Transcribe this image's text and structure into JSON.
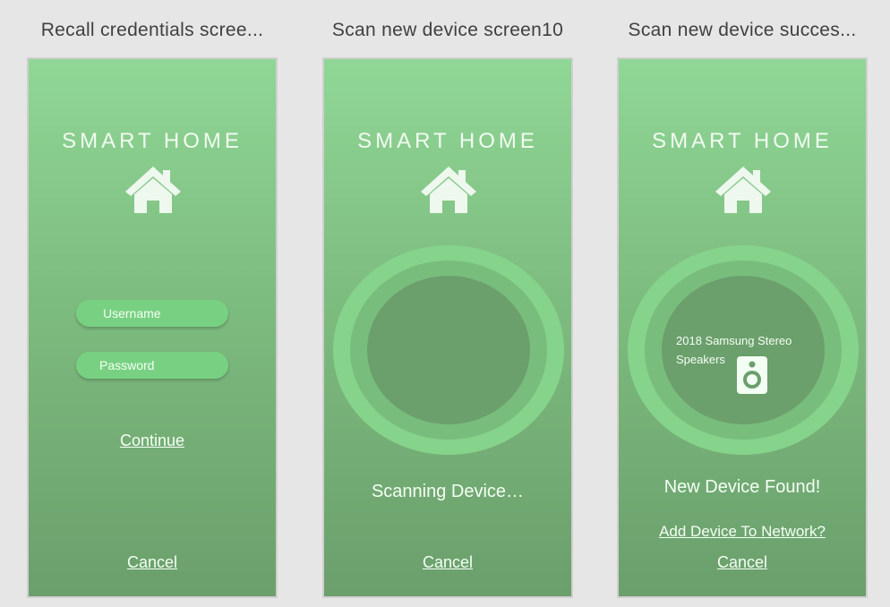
{
  "artboards": [
    {
      "title": "Recall credentials scree...",
      "brand": "SMART HOME",
      "username_placeholder": "Username",
      "password_placeholder": "Password",
      "continue_label": "Continue",
      "cancel_label": "Cancel"
    },
    {
      "title": "Scan new device screen10",
      "brand": "SMART HOME",
      "status": "Scanning Device…",
      "cancel_label": "Cancel"
    },
    {
      "title": "Scan new device succes...",
      "brand": "SMART HOME",
      "device_name": "2018 Samsung Stereo Speakers",
      "status": "New Device Found!",
      "add_device_label": "Add Device To Network?",
      "cancel_label": "Cancel"
    }
  ],
  "icons": {
    "brand": "house-icon",
    "device": "speaker-icon"
  },
  "colors": {
    "gradient_top": "#90d796",
    "gradient_bottom": "#6b9f6c",
    "field_fill": "#78d182",
    "text_light": "#f4fff4",
    "canvas_bg": "#e6e6e6"
  }
}
